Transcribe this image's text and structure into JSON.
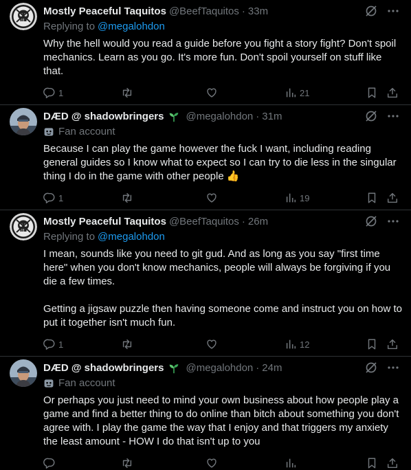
{
  "tweets": [
    {
      "name": "Mostly Peaceful Taquitos",
      "handle": "@BeefTaquitos",
      "time": "33m",
      "sprout": false,
      "reply_prefix": "Replying to",
      "reply_to": "@megalohdon",
      "badge": "",
      "avatar": "skull-avatar",
      "text": "Why the hell would you read a guide before you fight a story fight? Don't spoil mechanics. Learn as you go. It's more fun. Don't spoil yourself on stuff like that.",
      "replies": "1",
      "retweets": "",
      "likes": "",
      "views": "21"
    },
    {
      "name": "DÆD @ shadowbringers",
      "handle": "@megalohdon",
      "time": "31m",
      "sprout": true,
      "reply_prefix": "",
      "reply_to": "",
      "badge": "Fan account",
      "avatar": "person-avatar",
      "text": "Because I can play the game however the fuck I want, including reading general guides so I know what to expect so I can try to die less in the singular thing I do in the game with other people 👍",
      "replies": "1",
      "retweets": "",
      "likes": "",
      "views": "19"
    },
    {
      "name": "Mostly Peaceful Taquitos",
      "handle": "@BeefTaquitos",
      "time": "26m",
      "sprout": false,
      "reply_prefix": "Replying to",
      "reply_to": "@megalohdon",
      "badge": "",
      "avatar": "skull-avatar",
      "text": "I mean, sounds like you need to git gud. And as long as you say \"first time here\" when you don't know mechanics, people will always be forgiving if you die a few times.\n\nGetting a jigsaw puzzle then having someone come and instruct you on how to put it together isn't much fun.",
      "replies": "1",
      "retweets": "",
      "likes": "",
      "views": "12"
    },
    {
      "name": "DÆD @ shadowbringers",
      "handle": "@megalohdon",
      "time": "24m",
      "sprout": true,
      "reply_prefix": "",
      "reply_to": "",
      "badge": "Fan account",
      "avatar": "person-avatar",
      "text": "Or perhaps you just need to mind your own business about how people play a game and find a better thing to do online than bitch about something you don't agree with. I play the game the way that I enjoy and that triggers my anxiety the least amount - HOW I do that isn't up to you",
      "replies": "",
      "retweets": "",
      "likes": "",
      "views": ""
    }
  ],
  "colors": {
    "background": "#000000",
    "text": "#e7e9ea",
    "muted": "#71767b",
    "link": "#1d9bf0",
    "divider": "#2f3336"
  }
}
